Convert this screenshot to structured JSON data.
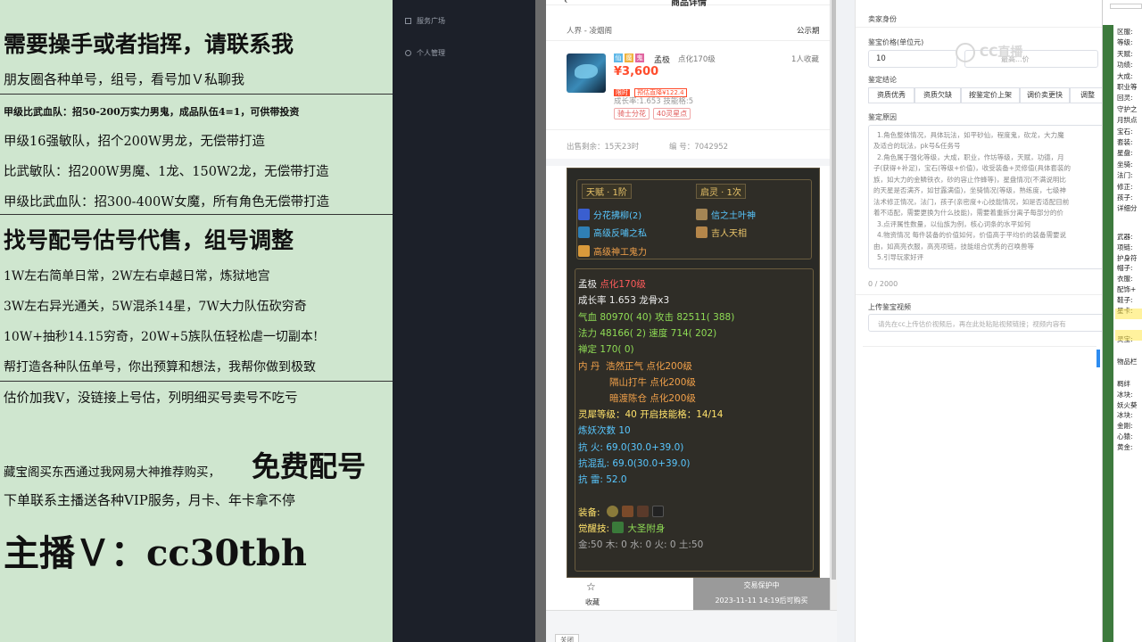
{
  "ad": {
    "lines": [
      "需要操手或者指挥，请联系我",
      "朋友圈各种单号，组号，看号加Ｖ私聊我",
      "甲级比武血队：招50-200万实力男鬼，成品队伍4=1，可供带投资",
      "甲级16强敏队，招个200W男龙，无偿带打造",
      "比武敏队：招200W男魔、1龙、150W2龙，无偿带打造",
      "甲级比武血队：招300-400W女魔，所有角色无偿带打造",
      "找号配号估号代售，组号调整",
      "1W左右简单日常，2W左右卓越日常，炼狱地宫",
      "3W左右异光通关，5W混杀14星，7W大力队伍砍穷奇",
      "10W+抽秒14.15穷奇，20W+5族队伍轻松虐一切副本!",
      "帮打造各种队伍单号，你出预算和想法，我帮你做到极致",
      "估价加我V，没链接上号估，列明细买号卖号不吃亏",
      "藏宝阁买东西通过我网易大神推荐购买，",
      "免费配号",
      "下单联系主播送各种VIP服务，月卡、年卡拿不停",
      "主播Ｖ：cc30tbh"
    ]
  },
  "nav": {
    "items": [
      "服务广场",
      "个人管理"
    ]
  },
  "product": {
    "header_title": "商品详情",
    "server": "人界 - 凌烟阁",
    "publicity": "公示期",
    "grade_badges": [
      "仙",
      "魔",
      "鬼"
    ],
    "char_class": "孟极",
    "level": "点化170级",
    "favorites": "1人收藏",
    "price": "¥3,600",
    "limited_label": "限时",
    "discount_label": "预估直降¥122.4",
    "growth": "成长率:1.653 技能格:5",
    "tags": [
      "骑士分花",
      "40灵星点"
    ],
    "sale_remaining": "出售剩余：15天23时",
    "serial": "编  号：7042952",
    "fav_label": "收藏",
    "protect_title": "交易保护中",
    "protect_time": "2023-11-11 14:19后可购买"
  },
  "card": {
    "talent_label": "天赋 · 1阶",
    "awaken_label": "启灵 · 1次",
    "skills_left": [
      "分花拂柳(2)",
      "高级反哺之私",
      "高级神工鬼力"
    ],
    "skills_right": [
      "信之土叶神",
      "吉人天相"
    ],
    "name": "孟极",
    "level": "点化170级",
    "growth": "成长率 1.653 龙骨x3",
    "hp": "气血 80970( 40)",
    "attack": "攻击 82511( 388)",
    "mana": "法力 48166( 2)",
    "speed": "速度 714( 202)",
    "zen": "禅定 170( 0)",
    "neidan_label": "内  丹",
    "neidan": [
      "浩然正气 点化200级",
      "隔山打牛 点化200级",
      "暗渡陈仓 点化200级"
    ],
    "soul": "灵犀等级：40 开启技能格：14/14",
    "refine": "炼妖次数 10",
    "res_fire": "抗  火: 69.0(30.0+39.0)",
    "res_chaos": "抗混乱: 69.0(30.0+39.0)",
    "res_thunder": "抗  雷: 52.0",
    "equip_label": "装备:",
    "awaken_skill_label": "觉醒技:",
    "awaken_skill": "大圣附身",
    "elements": "金:50 木: 0 水: 0 火: 0 土:50"
  },
  "form": {
    "section": "卖家身份",
    "price_label": "鉴宝价格(单位元)",
    "price_value": "10",
    "price_max_placeholder": "最高...价",
    "conclusion_label": "鉴定结论",
    "chips": [
      "资质优秀",
      "资质欠缺",
      "按鉴定价上架",
      "调价卖更快",
      "调整"
    ],
    "reason_label": "鉴定原因",
    "reason_lines": [
      "1.角色整体情况，具体玩法，如平砂仙，程度鬼，砍龙，大力魔",
      "及适合的玩法，pk号&任务号",
      "2.角色属于强化等级，大成，职业，作坊等级，天赋，功德，月",
      "子(获得+补足)，宝石(等级+价值)，收受装备+灵修值(具体套装的",
      "族，如大力的金鳞铁衣，砂的容止作蜂等)，星盘情况(不满说明比",
      "的天星是否满齐，如甘露满值)，坐骑情况(等级，熟练度，七级神",
      "法术修正情况，法门，孩子(亲密度+心技能情况，如是否适配目前",
      "着不适配，需要更换为什么技能)，需要着重拆分离子每部分的价",
      "3.点评属性数量，以仙族为例，核心词条的水平如何",
      "4.物资情况 每件装备的价值如何，价值高于平均价的装备需要说",
      "由，如高亮衣服，高亮项链，技能组合优秀的召唤兽等",
      "5.引导玩家好评"
    ],
    "counter": "0 / 2000",
    "video_label": "上传鉴宝视频",
    "video_placeholder": "请先在cc上传估价视频后，再在此处粘贴视频链接；视频内容有",
    "close_label": "关闭",
    "watermark": "CC直播"
  },
  "info": {
    "labels": [
      "区服:",
      "等级:",
      "天赋:",
      "功绩:",
      "大成:",
      "职业等",
      "回灵:",
      "守护之",
      "月拱点",
      "宝石:",
      "套装:",
      "星盘:",
      "坐骑:",
      "法门:",
      "修正:",
      "孩子:",
      "详细分"
    ],
    "labels2": [
      "武器:",
      "项链:",
      "护身符",
      "帽子:",
      "衣服:",
      "配饰+",
      "鞋子:",
      "星卡:"
    ],
    "labels3": [
      "灵宝:",
      "物品栏"
    ],
    "labels4": [
      "羁绊",
      "冰块:",
      "妖火葵",
      "冰块:",
      "金刚:",
      "心猿:",
      "黄金:"
    ]
  },
  "colors": {
    "ad_bg": "#cfe6cf",
    "price_red": "#ff4d2d",
    "card_bg": "#2a2a26",
    "info_green": "#3d7a3d"
  }
}
